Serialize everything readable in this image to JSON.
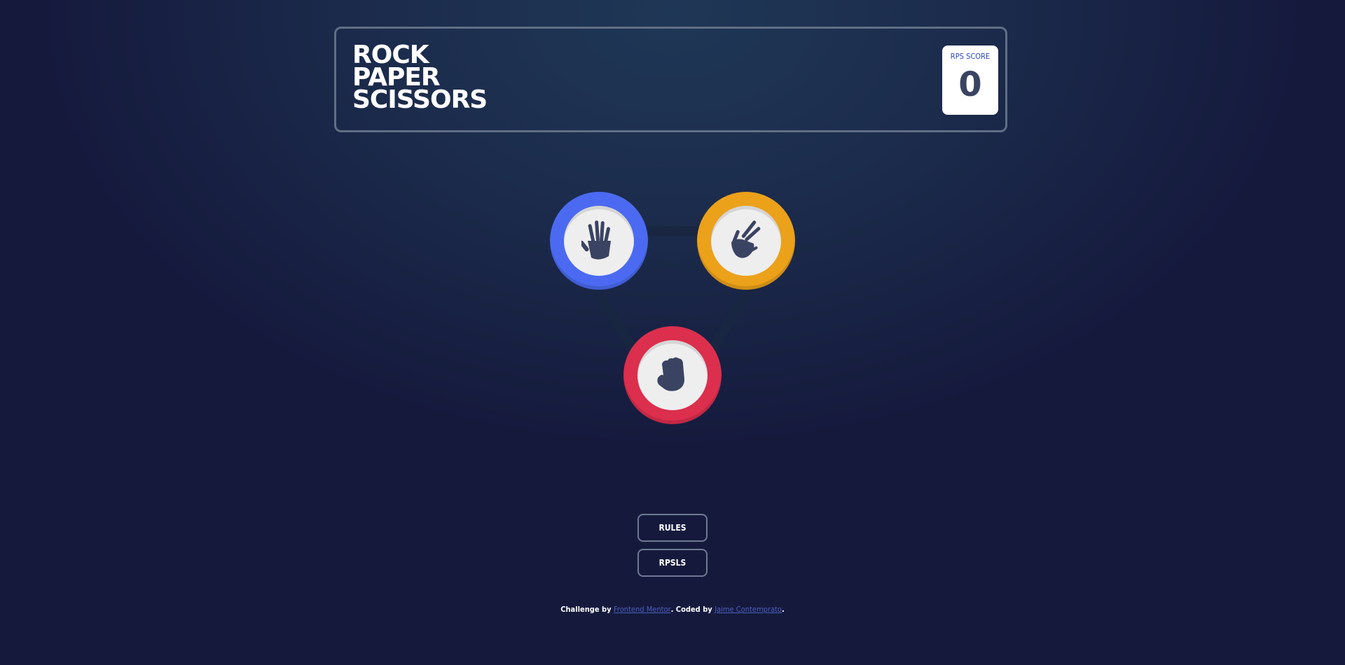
{
  "header": {
    "title_lines": [
      "ROCK",
      "PAPER",
      "SCISSORS"
    ],
    "score_label": "RPS SCORE",
    "score_value": "0"
  },
  "board": {
    "choices": [
      {
        "id": "paper",
        "icon": "hand-paper-icon",
        "color": "#4b6af1"
      },
      {
        "id": "scissors",
        "icon": "hand-scissors-icon",
        "color": "#eca11a"
      },
      {
        "id": "rock",
        "icon": "hand-rock-icon",
        "color": "#dc2e4d"
      }
    ]
  },
  "buttons": {
    "rules": "RULES",
    "rpsls": "RPSLS"
  },
  "footer": {
    "prefix": "Challenge by ",
    "link1": "Frontend Mentor",
    "middle": ". Coded by ",
    "link2": "Jaime Contemprato",
    "suffix": "."
  },
  "colors": {
    "background_top": "#1f3756",
    "background_bottom": "#151a3d",
    "score_label": "#2a46c0",
    "score_value": "#3b4363",
    "footer_link": "#4d5fbf"
  }
}
